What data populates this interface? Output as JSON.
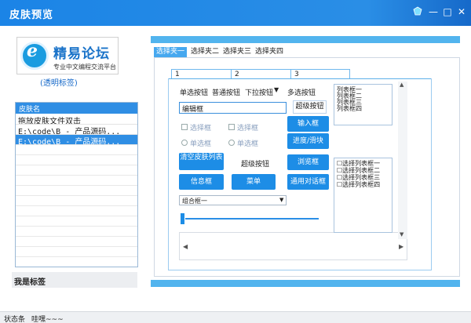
{
  "window": {
    "title": "皮肤预览",
    "controls": [
      "skin-icon",
      "minimize-icon",
      "maximize-icon",
      "close-icon"
    ]
  },
  "logo": {
    "main": "精易论坛",
    "sub": "专业中文编程交流平台"
  },
  "transparent_label": "(透明标签)",
  "skin_list": {
    "header": "皮肤名",
    "items": [
      "拖放皮肤文件双击",
      "E:\\code\\B - 产品源码...",
      "E:\\code\\B - 产品源码..."
    ],
    "selected_index": 2
  },
  "left_label": "我是标签",
  "top_tabs": [
    "选择夹一",
    "选择夹二",
    "选择夹三",
    "选择夹四"
  ],
  "inner_tabs": [
    "1",
    "2",
    "3"
  ],
  "controls": {
    "single_btn": "单选按钮",
    "normal_btn": "普通按钮",
    "dropdown_btn": "下拉按钮",
    "multi_btn": "多选按钮",
    "super_btn": "超级按钮",
    "edit_box": "编辑框",
    "input_btn": "输入框",
    "checkbox1": "选择框",
    "checkbox2": "选择框",
    "radio1": "单选框",
    "radio2": "单选框",
    "progress_btn": "进度/滑块",
    "clear_btn": "清空皮肤列表",
    "super_btn2": "超级按钮",
    "browse_btn": "浏览框",
    "info_btn": "信息框",
    "menu_btn": "菜单",
    "dialog_btn": "通用对话框",
    "combo": "组合框一"
  },
  "list_box": [
    "列表框一",
    "列表框二",
    "列表框三",
    "列表框四"
  ],
  "check_list": [
    "选择列表框一",
    "选择列表框二",
    "选择列表框三",
    "选择列表框四"
  ],
  "status": {
    "label": "状态条",
    "text": "哇嘿~~~"
  },
  "colors": {
    "accent": "#1d8de6",
    "title_bar": "#1b84e6",
    "selected_row": "#2f8ee4"
  }
}
